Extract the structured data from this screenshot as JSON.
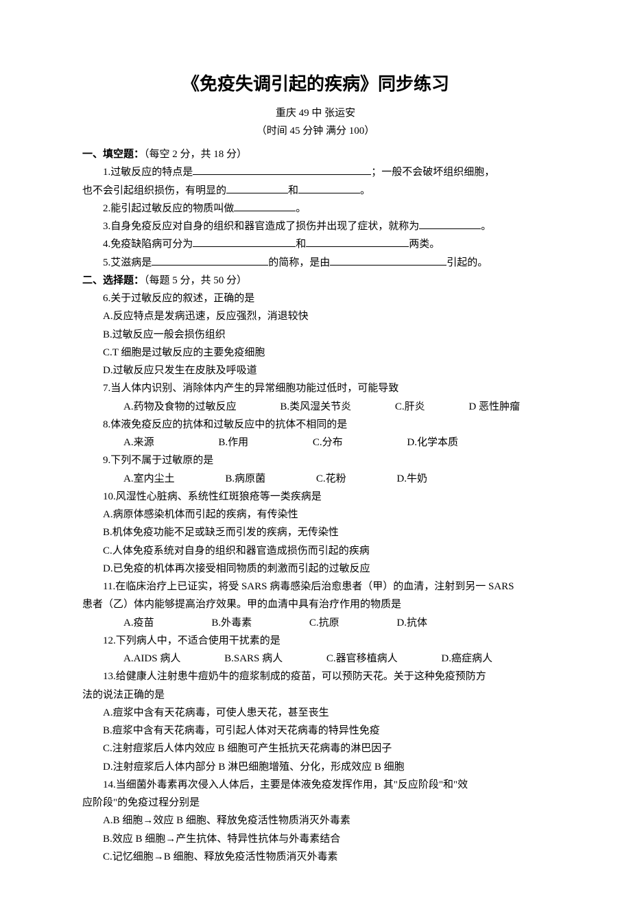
{
  "title": "《免疫失调引起的疾病》同步练习",
  "subtitle": "重庆 49 中    张运安",
  "meta": "（时间 45 分钟  满分 100）",
  "sec1": {
    "header": "一、填空题：",
    "note": "（每空 2 分，共 18 分）",
    "q1a": "1.过敏反应的特点是",
    "q1b": "；一般不会破坏组织细胞，",
    "q1c": "也不会引起组织损伤，有明显的",
    "q1d": "和",
    "q1e": "。",
    "q2a": "2.能引起过敏反应的物质叫做",
    "q2b": "。",
    "q3a": "3.自身免疫反应对自身的组织和器官造成了损伤并出现了症状，就称为",
    "q3b": "。",
    "q4a": "4.免疫缺陷病可分为",
    "q4b": "和",
    "q4c": "两类。",
    "q5a": "5.艾滋病是",
    "q5b": "的简称，是由",
    "q5c": "引起的。"
  },
  "sec2": {
    "header": "二、选择题：",
    "note": "（每题 5 分，共 50 分）",
    "q6": {
      "stem": "6.关于过敏反应的叙述，正确的是",
      "A": "A.反应特点是发病迅速，反应强烈，消退较快",
      "B": "B.过敏反应一般会损伤组织",
      "C": "C.T 细胞是过敏反应的主要免疫细胞",
      "D": "D.过敏反应只发生在皮肤及呼吸道"
    },
    "q7": {
      "stem": "7.当人体内识别、消除体内产生的异常细胞功能过低时，可能导致",
      "A": "A.药物及食物的过敏反应",
      "B": "B.类风湿关节炎",
      "C": "C.肝炎",
      "D": "D 恶性肿瘤"
    },
    "q8": {
      "stem": "8.体液免疫反应的抗体和过敏反应中的抗体不相同的是",
      "A": "A.来源",
      "B": "B.作用",
      "C": "C.分布",
      "D": "D.化学本质"
    },
    "q9": {
      "stem": "9.下列不属于过敏原的是",
      "A": "A.室内尘土",
      "B": "B.病原菌",
      "C": "C.花粉",
      "D": "D.牛奶"
    },
    "q10": {
      "stem": "10.风湿性心脏病、系统性红斑狼疮等一类疾病是",
      "A": "A.病原体感染机体而引起的疾病，有传染性",
      "B": "B.机体免疫功能不足或缺乏而引发的疾病，无传染性",
      "C": "C.人体免疫系统对自身的组织和器官造成损伤而引起的疾病",
      "D": "D.已免疫的机体再次接受相同物质的刺激而引起的过敏反应"
    },
    "q11": {
      "stem1": "11.在临床治疗上已证实，将受 SARS 病毒感染后治愈患者（甲）的血清，注射到另一 SARS",
      "stem2": "患者（乙）体内能够提高治疗效果。甲的血清中具有治疗作用的物质是",
      "A": "A.疫苗",
      "B": "B.外毒素",
      "C": "C.抗原",
      "D": "D.抗体"
    },
    "q12": {
      "stem": "12.下列病人中，不适合使用干扰素的是",
      "A": "A.AIDS 病人",
      "B": "B.SARS 病人",
      "C": "C.器官移植病人",
      "D": "D.癌症病人"
    },
    "q13": {
      "stem1": "13.给健康人注射患牛痘奶牛的痘浆制成的疫苗，可以预防天花。关于这种免疫预防方",
      "stem2": "法的说法正确的是",
      "A": "A.痘浆中含有天花病毒，可使人患天花，甚至丧生",
      "B": "B.痘浆中含有天花病毒，可引起人体对天花病毒的特异性免疫",
      "C": "C.注射痘浆后人体内效应 B 细胞可产生抵抗天花病毒的淋巴因子",
      "D": "D.注射痘浆后人体内部分 B 淋巴细胞增殖、分化，形成效应 B 细胞"
    },
    "q14": {
      "stem1": "14.当细菌外毒素再次侵入人体后，主要是体液免疫发挥作用，其\"反应阶段\"和\"效",
      "stem2": "应阶段\"的免疫过程分别是",
      "A": "A.B 细胞→效应 B 细胞、释放免疫活性物质消灭外毒素",
      "B": "B.效应 B 细胞→产生抗体、特异性抗体与外毒素结合",
      "C": "C.记忆细胞→B 细胞、释放免疫活性物质消灭外毒素"
    }
  }
}
